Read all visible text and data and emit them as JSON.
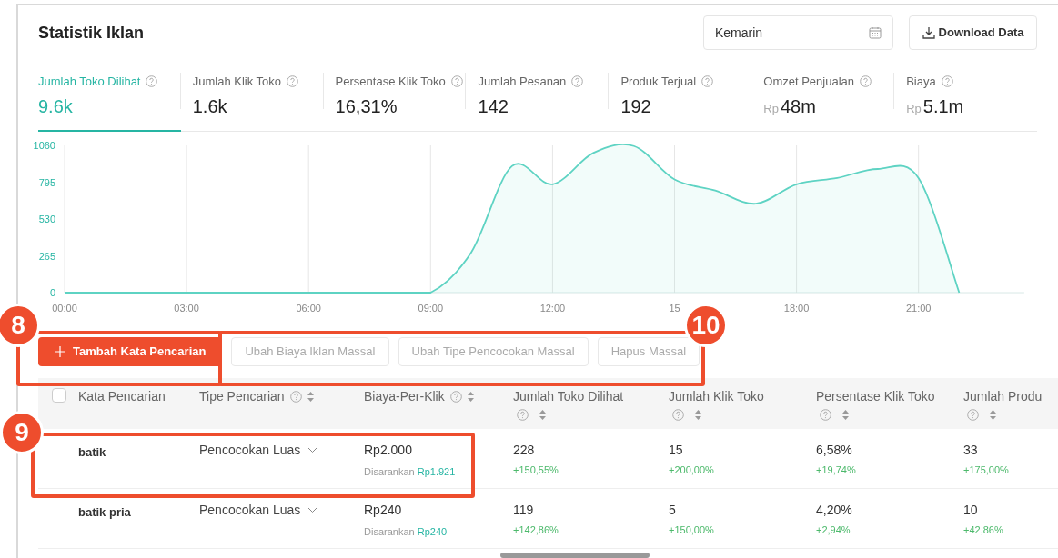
{
  "header": {
    "title": "Statistik Iklan",
    "date_field": {
      "value": "Kemarin"
    },
    "download_button": "Download Data"
  },
  "metrics": [
    {
      "label": "Jumlah Toko Dilihat",
      "value": "9.6k",
      "selected": true
    },
    {
      "label": "Jumlah Klik Toko",
      "value": "1.6k",
      "selected": false
    },
    {
      "label": "Persentase Klik Toko",
      "value": "16,31%",
      "selected": false
    },
    {
      "label": "Jumlah Pesanan",
      "value": "142",
      "selected": false
    },
    {
      "label": "Produk Terjual",
      "value": "192",
      "selected": false
    },
    {
      "label": "Omzet Penjualan",
      "prefix": "Rp",
      "value": "48m",
      "selected": false
    },
    {
      "label": "Biaya",
      "prefix": "Rp",
      "value": "5.1m",
      "selected": false
    }
  ],
  "chart": {
    "chart_data": {
      "type": "area",
      "x": [
        0,
        1,
        2,
        3,
        4,
        5,
        6,
        7,
        8,
        9,
        10,
        11,
        12,
        13,
        14,
        15,
        16,
        17,
        18,
        19,
        20,
        21,
        22
      ],
      "grid": true,
      "series": [
        {
          "color": "#5ed3c3",
          "values": [
            0,
            0,
            0,
            0,
            0,
            0,
            0,
            0,
            0,
            0,
            290,
            910,
            780,
            1005,
            1055,
            815,
            735,
            640,
            780,
            825,
            890,
            825,
            0
          ]
        }
      ],
      "xlim": [
        0,
        23.6
      ],
      "ylim": [
        0,
        1060
      ],
      "xticks": [
        {
          "value": 0,
          "label": "00:00"
        },
        {
          "value": 3,
          "label": "03:00"
        },
        {
          "value": 6,
          "label": "06:00"
        },
        {
          "value": 9,
          "label": "09:00"
        },
        {
          "value": 12,
          "label": "12:00"
        },
        {
          "value": 15,
          "label": "15"
        },
        {
          "value": 18,
          "label": "18:00"
        },
        {
          "value": 21,
          "label": "21:00"
        }
      ],
      "yticks": [
        0,
        265,
        530,
        795,
        1060
      ]
    }
  },
  "actions": [
    {
      "label": "Tambah Kata Pencarian",
      "kind": "primary"
    },
    {
      "label": "Ubah Biaya Iklan Massal",
      "kind": "secondary"
    },
    {
      "label": "Ubah Tipe Pencocokan Massal",
      "kind": "secondary"
    },
    {
      "label": "Hapus Massal",
      "kind": "secondary"
    }
  ],
  "table": {
    "select_all": {
      "checked": false
    },
    "columns": [
      {
        "label": "Kata Pencarian",
        "kind": "plain"
      },
      {
        "label": "Tipe Pencarian",
        "kind": "sortable"
      },
      {
        "label": "Biaya-Per-Klik",
        "kind": "sortable"
      },
      {
        "label": "Jumlah Toko Dilihat",
        "kind": "sortable"
      },
      {
        "label": "Jumlah Klik Toko",
        "kind": "sortable"
      },
      {
        "label": "Persentase Klik Toko",
        "kind": "sortable"
      },
      {
        "label": "Jumlah Produ",
        "kind": "sortable"
      }
    ],
    "rows": [
      {
        "keyword": "batik",
        "match_type": "Pencocokan Luas",
        "bid": "Rp2.000",
        "suggested_label": "Disarankan",
        "suggested": "Rp1.921",
        "stats": [
          {
            "value": "228",
            "change": "+150,55%"
          },
          {
            "value": "15",
            "change": "+200,00%"
          },
          {
            "value": "6,58%",
            "change": "+19,74%"
          },
          {
            "value": "33",
            "change": "+175,00%"
          }
        ]
      },
      {
        "keyword": "batik pria",
        "match_type": "Pencocokan Luas",
        "bid": "Rp240",
        "suggested_label": "Disarankan",
        "suggested": "Rp240",
        "stats": [
          {
            "value": "119",
            "change": "+142,86%"
          },
          {
            "value": "5",
            "change": "+150,00%"
          },
          {
            "value": "4,20%",
            "change": "+2,94%"
          },
          {
            "value": "10",
            "change": "+42,86%"
          }
        ]
      }
    ]
  },
  "callouts": [
    {
      "number": "8"
    },
    {
      "number": "9"
    },
    {
      "number": "10"
    }
  ]
}
